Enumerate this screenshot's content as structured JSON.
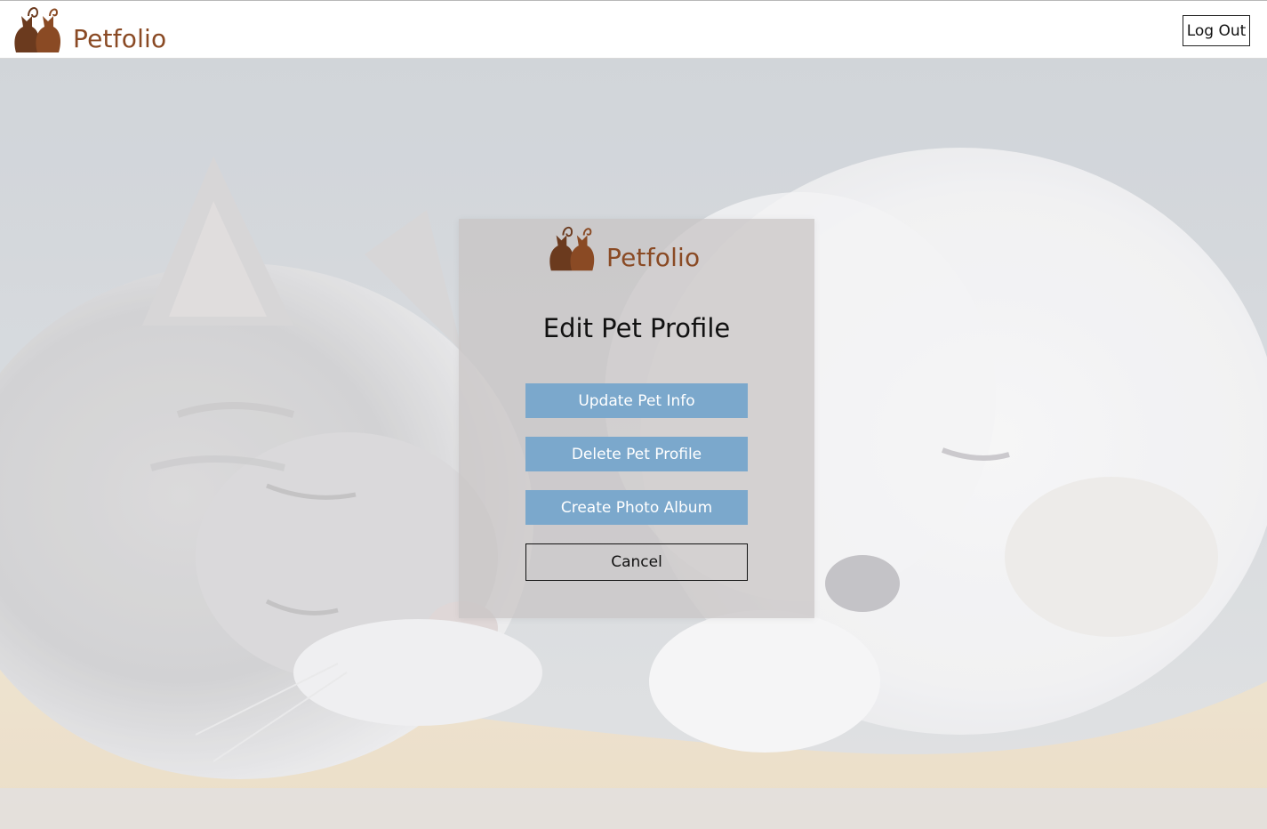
{
  "app": {
    "brand_name": "Petfolio",
    "logo_icon": "cats-silhouette-logo-icon"
  },
  "header": {
    "logout_label": "Log Out"
  },
  "modal": {
    "brand_name": "Petfolio",
    "title": "Edit Pet Profile",
    "buttons": {
      "update": "Update Pet Info",
      "delete": "Delete Pet Profile",
      "album": "Create Photo Album",
      "cancel": "Cancel"
    }
  },
  "colors": {
    "brand": "#8a4a24",
    "primary_button": "#7ba8cc",
    "modal_overlay": "#c8c4c4"
  },
  "background": {
    "description_icon": "sleeping-kitten-and-puppy-photo"
  }
}
